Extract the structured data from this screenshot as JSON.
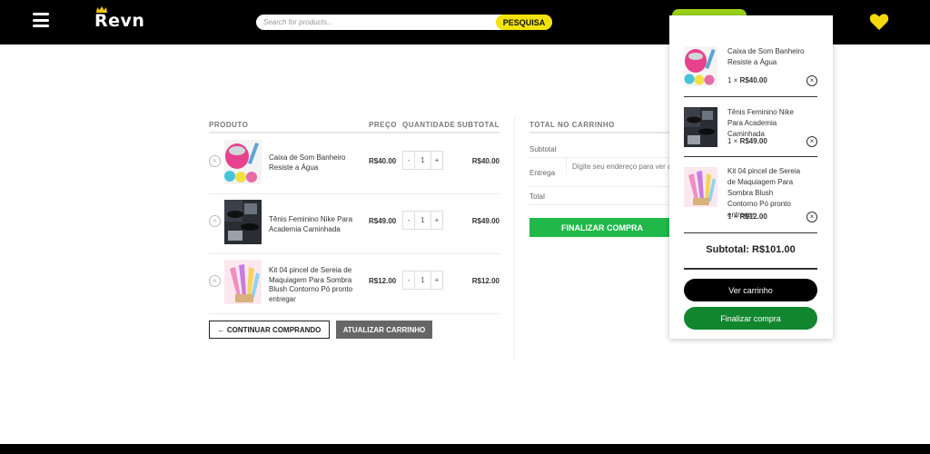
{
  "header": {
    "logo_text": "Revn",
    "search_placeholder": "Search for products...",
    "search_button": "PESQUISA",
    "colors": {
      "bar": "#000000",
      "accent_yellow": "#f2e30b",
      "cart_pill": "#9bd31a"
    }
  },
  "cart": {
    "headers": {
      "product": "PRODUTO",
      "price": "PREÇO",
      "quantity": "QUANTIDADE",
      "subtotal": "SUBTOTAL"
    },
    "items": [
      {
        "name": "Caixa de Som Banheiro Resiste a Água",
        "price": "R$40.00",
        "qty_minus": "-",
        "qty": "1",
        "qty_plus": "+",
        "subtotal": "R$40.00",
        "remove": "×"
      },
      {
        "name": "Tênis Feminino Nike Para Academia Caminhada",
        "price": "R$49.00",
        "qty_minus": "-",
        "qty": "1",
        "qty_plus": "+",
        "subtotal": "R$49.00",
        "remove": "×"
      },
      {
        "name": "Kit 04 pincel de Sereia de Maquiagem Para Sombra Blush Contorno Pó pronto entregar",
        "price": "R$12.00",
        "qty_minus": "-",
        "qty": "1",
        "qty_plus": "+",
        "subtotal": "R$12.00",
        "remove": "×"
      }
    ],
    "continue_button": "← CONTINUAR COMPRANDO",
    "update_button": "ATUALIZAR CARRINHO"
  },
  "totals": {
    "heading": "TOTAL NO CARRINHO",
    "subtotal_label": "Subtotal",
    "shipping_label": "Entrega",
    "shipping_text": "Digite seu endereço para ver as",
    "total_label": "Total",
    "checkout_button": "FINALIZAR COMPRA",
    "checkout_color": "#20b949"
  },
  "mini_cart": {
    "items": [
      {
        "name": "Caixa de Som Banheiro Resiste a Água",
        "qty_prefix": "1 × ",
        "price": "R$40.00",
        "remove": "×"
      },
      {
        "name": "Tênis Feminino Nike Para Academia Caminhada",
        "qty_prefix": "1 × ",
        "price": "R$49.00",
        "remove": "×"
      },
      {
        "name": "Kit 04 pincel de Sereia de Maquiagem Para Sombra Blush Contorno Pó pronto entregar",
        "qty_prefix": "1 × ",
        "price": "R$12.00",
        "remove": "×"
      }
    ],
    "subtotal": "Subtotal: R$101.00",
    "view_cart_button": "Ver carrinho",
    "checkout_button": "Finalizar compra",
    "checkout_color": "#12862f"
  }
}
